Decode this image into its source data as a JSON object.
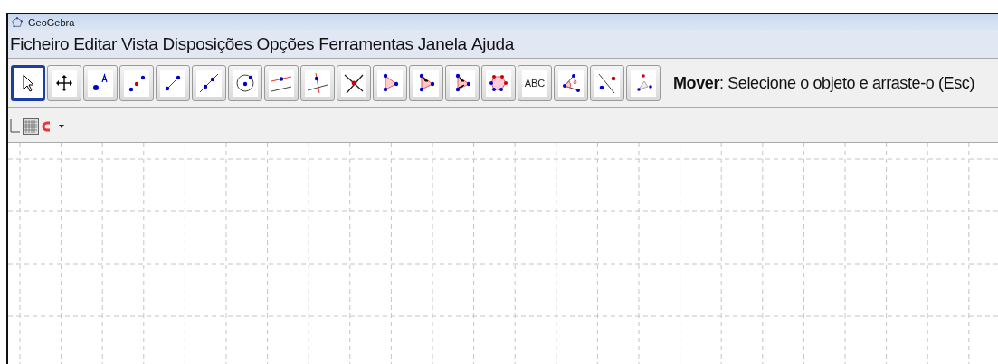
{
  "window": {
    "title": "GeoGebra"
  },
  "menu": [
    "Ficheiro",
    "Editar",
    "Vista",
    "Disposições",
    "Opções",
    "Ferramentas",
    "Janela",
    "Ajuda"
  ],
  "tools": [
    {
      "kind": "pointer",
      "selected": true
    },
    {
      "kind": "move",
      "selected": false
    },
    {
      "kind": "point",
      "selected": false
    },
    {
      "kind": "midpoint",
      "selected": false
    },
    {
      "kind": "segment",
      "selected": false
    },
    {
      "kind": "line",
      "selected": false
    },
    {
      "kind": "circle",
      "selected": false
    },
    {
      "kind": "parallel",
      "selected": false
    },
    {
      "kind": "perpendicular",
      "selected": false
    },
    {
      "kind": "intersect",
      "selected": false
    },
    {
      "kind": "polygon",
      "selected": false
    },
    {
      "kind": "polygon-arrow",
      "selected": false
    },
    {
      "kind": "polygon-arrows",
      "selected": false
    },
    {
      "kind": "pentagon",
      "selected": false
    },
    {
      "kind": "text",
      "label": "ABC",
      "selected": false
    },
    {
      "kind": "angle",
      "selected": false
    },
    {
      "kind": "reflect",
      "selected": false
    },
    {
      "kind": "rotate",
      "selected": false
    }
  ],
  "tool_help": "**Mover**: Selecione o objeto e arraste-o (Esc)"
}
